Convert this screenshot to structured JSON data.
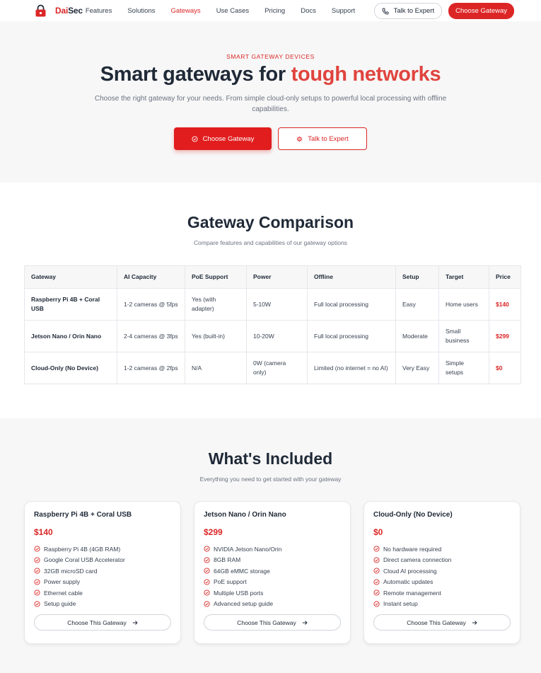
{
  "nav": {
    "brand_a": "Dai",
    "brand_b": "Sec",
    "links": [
      "Features",
      "Solutions",
      "Gateways",
      "Use Cases",
      "Pricing",
      "Docs",
      "Support"
    ],
    "talk_label": "Talk to Expert",
    "choose_label": "Choose Gateway"
  },
  "hero": {
    "eyebrow": "SMART GATEWAY DEVICES",
    "title_a": "Smart gateways for ",
    "title_b": "tough networks",
    "subtitle": "Choose the right gateway for your needs. From simple cloud-only setups to powerful local processing with offline capabilities.",
    "primary_btn": "Choose Gateway",
    "secondary_btn": "Talk to Expert"
  },
  "comparison": {
    "title": "Gateway Comparison",
    "subtitle": "Compare features and capabilities of our gateway options",
    "headers": [
      "Gateway",
      "AI Capacity",
      "PoE Support",
      "Power",
      "Offline",
      "Setup",
      "Target",
      "Price"
    ],
    "rows": [
      [
        "Raspberry Pi 4B + Coral USB",
        "1-2 cameras @ 5fps",
        "Yes (with adapter)",
        "5-10W",
        "Full local processing",
        "Easy",
        "Home users",
        "$140"
      ],
      [
        "Jetson Nano / Orin Nano",
        "2-4 cameras @ 3fps",
        "Yes (built-in)",
        "10-20W",
        "Full local processing",
        "Moderate",
        "Small business",
        "$299"
      ],
      [
        "Cloud-Only (No Device)",
        "1-2 cameras @ 2fps",
        "N/A",
        "0W (camera only)",
        "Limited (no internet = no AI)",
        "Very Easy",
        "Simple setups",
        "$0"
      ]
    ]
  },
  "included": {
    "title": "What's Included",
    "subtitle": "Everything you need to get started with your gateway",
    "cards": [
      {
        "name": "Raspberry Pi 4B + Coral USB",
        "price": "$140",
        "features": [
          "Raspberry Pi 4B (4GB RAM)",
          "Google Coral USB Accelerator",
          "32GB microSD card",
          "Power supply",
          "Ethernet cable",
          "Setup guide"
        ],
        "button": "Choose This Gateway"
      },
      {
        "name": "Jetson Nano / Orin Nano",
        "price": "$299",
        "features": [
          "NVIDIA Jetson Nano/Orin",
          "8GB RAM",
          "64GB eMMC storage",
          "PoE support",
          "Multiple USB ports",
          "Advanced setup guide"
        ],
        "button": "Choose This Gateway"
      },
      {
        "name": "Cloud-Only (No Device)",
        "price": "$0",
        "features": [
          "No hardware required",
          "Direct camera connection",
          "Cloud AI processing",
          "Automatic updates",
          "Remote management",
          "Instant setup"
        ],
        "button": "Choose This Gateway"
      }
    ]
  },
  "colors": {
    "accent": "#dc2626",
    "text": "#1f2937",
    "muted": "#6b7280"
  }
}
